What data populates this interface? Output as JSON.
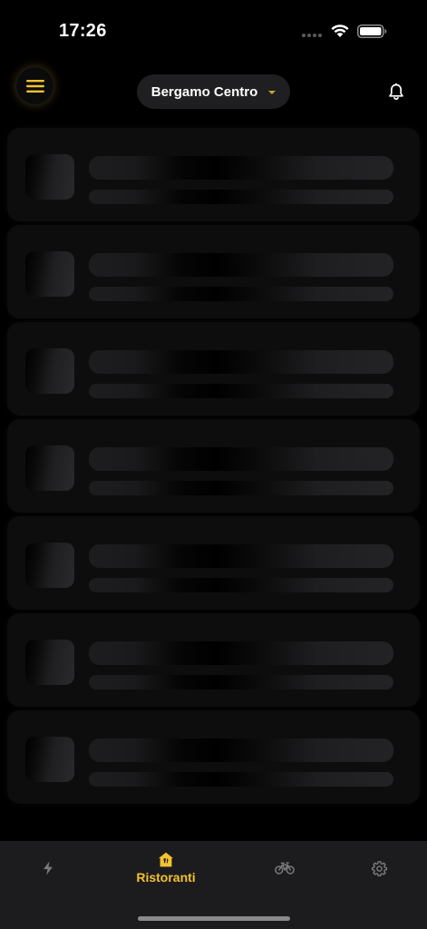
{
  "status_bar": {
    "time": "17:26"
  },
  "header": {
    "location": "Bergamo Centro",
    "menu_icon": "hamburger-menu-icon",
    "dropdown_icon": "chevron-down-icon",
    "bell_icon": "bell-icon"
  },
  "skeleton_items": 7,
  "tab_bar": {
    "tabs": [
      {
        "name": "flash",
        "icon": "lightning-icon",
        "label": ""
      },
      {
        "name": "ristoranti",
        "icon": "restaurant-icon",
        "label": "Ristoranti",
        "active": true
      },
      {
        "name": "delivery",
        "icon": "bicycle-icon",
        "label": ""
      },
      {
        "name": "settings",
        "icon": "gear-icon",
        "label": ""
      }
    ]
  },
  "colors": {
    "accent": "#f2c230",
    "background": "#000000",
    "tab_bar": "#1c1c1e",
    "pill": "#1f1f21",
    "inactive_icon": "#7a7a7c"
  }
}
